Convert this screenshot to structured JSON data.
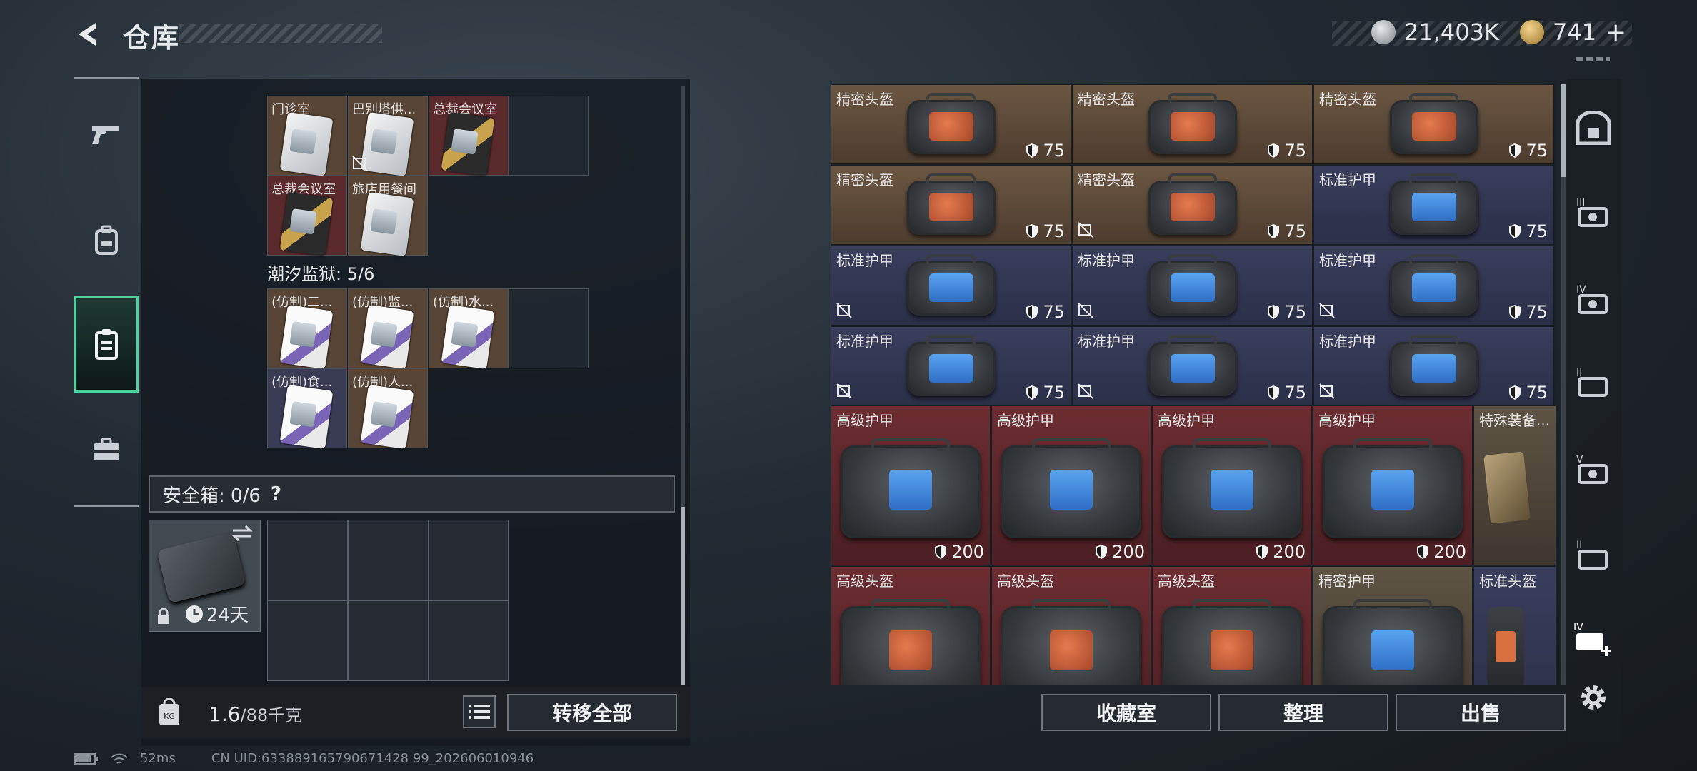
{
  "header": {
    "title": "仓库"
  },
  "currency": {
    "coins": "21,403K",
    "premium": "741",
    "premium_add": "+"
  },
  "left": {
    "top_cards": [
      {
        "label": "门诊室",
        "bg": "brown",
        "style": "white",
        "noswap": false
      },
      {
        "label": "巴别塔供...",
        "bg": "brown",
        "style": "white",
        "noswap": true
      },
      {
        "label": "总裁会议室",
        "bg": "red",
        "style": "gold",
        "noswap": false
      },
      {
        "label": "总裁会议室",
        "bg": "red",
        "style": "gold",
        "noswap": false
      },
      {
        "label": "旅店用餐间",
        "bg": "brown",
        "style": "white",
        "noswap": false
      }
    ],
    "prison_title": "潮汐监狱: 5/6",
    "prison_cards": [
      {
        "label": "(仿制)二...",
        "bg": "brown",
        "style": "pc"
      },
      {
        "label": "(仿制)监...",
        "bg": "brown",
        "style": "pc"
      },
      {
        "label": "(仿制)水...",
        "bg": "brown",
        "style": "pc"
      },
      {
        "label": "(仿制)食...",
        "bg": "purple",
        "style": "pc"
      },
      {
        "label": "(仿制)人...",
        "bg": "brown",
        "style": "pc"
      }
    ],
    "safe_title": "安全箱: 0/6",
    "safe_help": "?",
    "safe_days": "24天",
    "weight": "1.6",
    "weight_max": "/88千克",
    "transfer_all": "转移全部"
  },
  "right": {
    "items": [
      {
        "label": "精密头盔",
        "val": "75",
        "bg": "brown",
        "kind": "helmet",
        "noswap": false
      },
      {
        "label": "精密头盔",
        "val": "75",
        "bg": "brown",
        "kind": "helmet",
        "noswap": false
      },
      {
        "label": "精密头盔",
        "val": "75",
        "bg": "brown",
        "kind": "helmet",
        "noswap": false
      },
      {
        "label": "精密头盔",
        "val": "75",
        "bg": "brown",
        "kind": "helmet",
        "noswap": false
      },
      {
        "label": "精密头盔",
        "val": "75",
        "bg": "brown",
        "kind": "helmet",
        "noswap": true
      },
      {
        "label": "标准护甲",
        "val": "75",
        "bg": "blue",
        "kind": "armor",
        "noswap": false
      },
      {
        "label": "标准护甲",
        "val": "75",
        "bg": "blue",
        "kind": "armor",
        "noswap": true
      },
      {
        "label": "标准护甲",
        "val": "75",
        "bg": "blue",
        "kind": "armor",
        "noswap": true
      },
      {
        "label": "标准护甲",
        "val": "75",
        "bg": "blue",
        "kind": "armor",
        "noswap": true
      },
      {
        "label": "标准护甲",
        "val": "75",
        "bg": "blue",
        "kind": "armor",
        "noswap": true
      },
      {
        "label": "标准护甲",
        "val": "75",
        "bg": "blue",
        "kind": "armor",
        "noswap": true
      },
      {
        "label": "标准护甲",
        "val": "75",
        "bg": "blue",
        "kind": "armor",
        "noswap": true
      }
    ],
    "big_items": [
      {
        "label": "高级护甲",
        "val": "200",
        "bg": "red",
        "kind": "armor"
      },
      {
        "label": "高级护甲",
        "val": "200",
        "bg": "red",
        "kind": "armor"
      },
      {
        "label": "高级护甲",
        "val": "200",
        "bg": "red",
        "kind": "armor"
      },
      {
        "label": "高级护甲",
        "val": "200",
        "bg": "red",
        "kind": "armor"
      },
      {
        "label": "高级头盔",
        "val": "",
        "bg": "red",
        "kind": "helmet"
      },
      {
        "label": "高级头盔",
        "val": "",
        "bg": "red",
        "kind": "helmet"
      },
      {
        "label": "高级头盔",
        "val": "",
        "bg": "red",
        "kind": "helmet"
      },
      {
        "label": "精密护甲",
        "val": "",
        "bg": "khaki",
        "kind": "armor"
      }
    ],
    "special_label": "特殊装备...",
    "std_helmet_label": "标准头盔",
    "buttons": {
      "collection": "收藏室",
      "sort": "整理",
      "sell": "出售"
    }
  },
  "status": {
    "ping": "52ms",
    "uid": "CN UID:633889165790671428 99_202606010946"
  },
  "colors": {
    "accent": "#47d6a0",
    "brown": "#5e4a38",
    "red": "#5a2a2d",
    "blue": "#33365a"
  }
}
